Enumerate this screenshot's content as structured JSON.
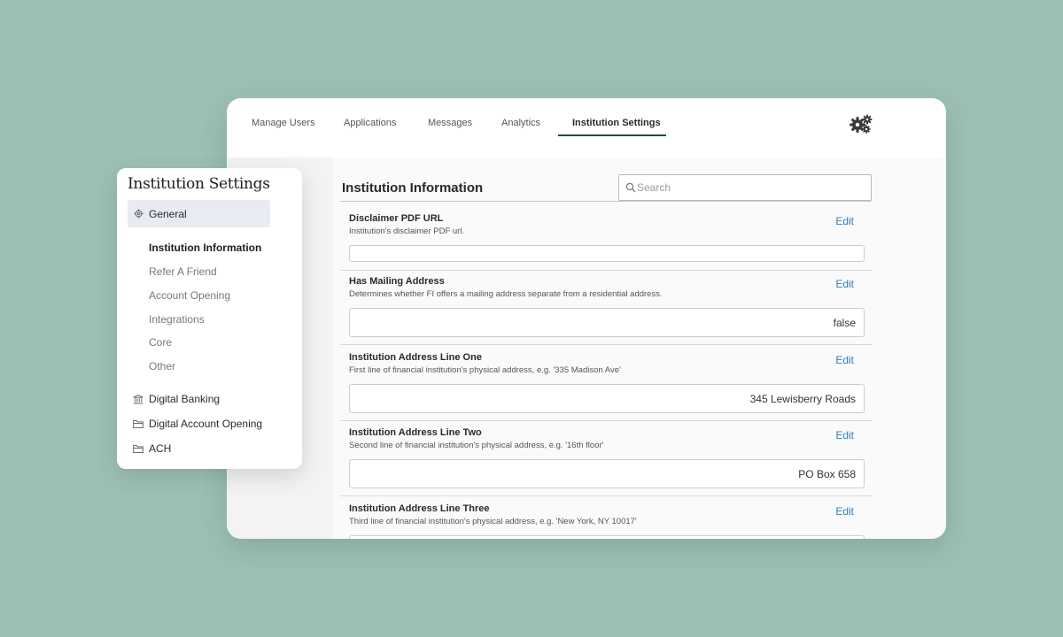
{
  "nav": {
    "tabs": [
      {
        "label": "Manage Users"
      },
      {
        "label": "Applications"
      },
      {
        "label": "Messages"
      },
      {
        "label": "Analytics"
      },
      {
        "label": "Institution Settings",
        "active": true
      }
    ],
    "settings_icon": "gears-icon"
  },
  "main": {
    "title": "Institution Information",
    "search_placeholder": "Search",
    "edit_label": "Edit",
    "fields": [
      {
        "label": "Disclaimer PDF URL",
        "description": "Institution's disclaimer PDF url.",
        "value": ""
      },
      {
        "label": "Has Mailing Address",
        "description": "Determines whether FI offers a mailing address separate from a residential address.",
        "value": "false"
      },
      {
        "label": "Institution Address Line One",
        "description": "First line of financial institution's physical address, e.g. '335 Madison Ave'",
        "value": "345 Lewisberry Roads"
      },
      {
        "label": "Institution Address Line Two",
        "description": "Second line of financial institution's physical address, e.g. '16th floor'",
        "value": "PO Box 658"
      },
      {
        "label": "Institution Address Line Three",
        "description": "Third line of financial institution's physical address, e.g. 'New York, NY 10017'",
        "value": ""
      }
    ]
  },
  "sidebar": {
    "title": "Institution Settings",
    "general": {
      "label": "General",
      "icon": "gear-icon"
    },
    "sub_items": [
      {
        "label": "Institution Information",
        "active": true
      },
      {
        "label": "Refer A Friend"
      },
      {
        "label": "Account Opening"
      },
      {
        "label": "Integrations"
      },
      {
        "label": "Core"
      },
      {
        "label": "Other"
      }
    ],
    "groups": [
      {
        "label": "Digital Banking",
        "icon": "bank-icon"
      },
      {
        "label": "Digital Account Opening",
        "icon": "folder-icon"
      },
      {
        "label": "ACH",
        "icon": "folder-icon"
      }
    ]
  },
  "colors": {
    "background": "#9dbfb5",
    "accent": "#1f4a3c",
    "link": "#2f7fb8",
    "selected_nav": "#e8ebf2"
  }
}
